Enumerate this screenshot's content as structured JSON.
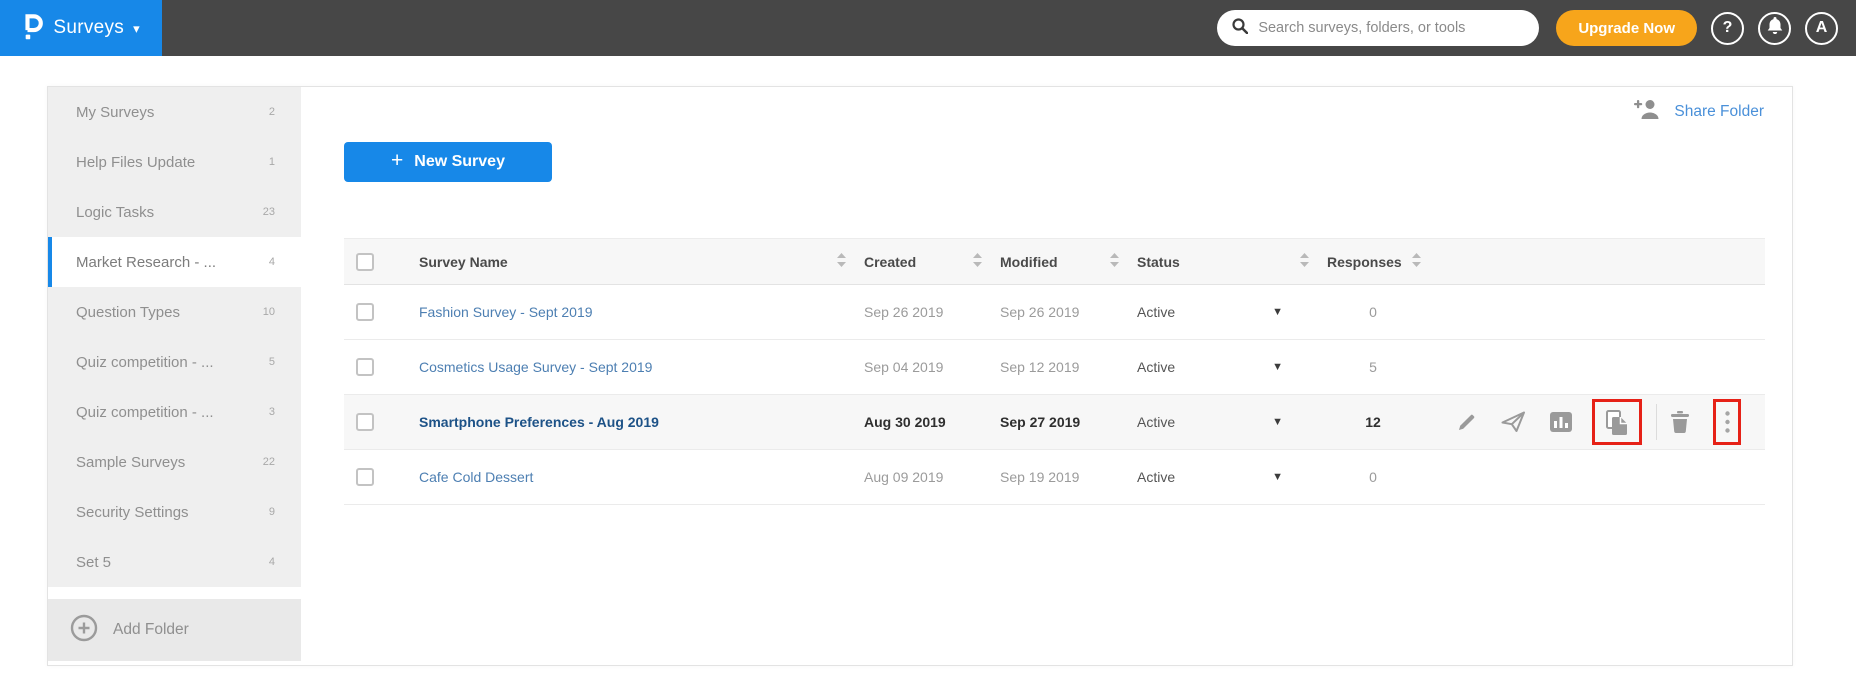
{
  "topbar": {
    "app_name": "Surveys",
    "search_placeholder": "Search surveys, folders, or tools",
    "upgrade_label": "Upgrade Now",
    "help_label": "?",
    "avatar_letter": "A"
  },
  "sidebar": {
    "items": [
      {
        "label": "My Surveys",
        "count": "2"
      },
      {
        "label": "Help Files Update",
        "count": "1"
      },
      {
        "label": "Logic Tasks",
        "count": "23"
      },
      {
        "label": "Market Research - ...",
        "count": "4"
      },
      {
        "label": "Question Types",
        "count": "10"
      },
      {
        "label": "Quiz competition - ...",
        "count": "5"
      },
      {
        "label": "Quiz competition - ...",
        "count": "3"
      },
      {
        "label": "Sample Surveys",
        "count": "22"
      },
      {
        "label": "Security Settings",
        "count": "9"
      },
      {
        "label": "Set 5",
        "count": "4"
      }
    ],
    "active_item": "Market Research - ...",
    "add_folder_label": "Add Folder"
  },
  "main": {
    "share_folder_label": "Share Folder",
    "new_survey_label": "New Survey",
    "new_survey_plus": "+",
    "table": {
      "headers": [
        "Survey Name",
        "Created",
        "Modified",
        "Status",
        "Responses"
      ],
      "rows": [
        {
          "name": "Fashion Survey - Sept 2019",
          "created": "Sep 26 2019",
          "modified": "Sep 26 2019",
          "status": "Active",
          "responses": "0"
        },
        {
          "name": "Cosmetics Usage Survey - Sept 2019",
          "created": "Sep 04 2019",
          "modified": "Sep 12 2019",
          "status": "Active",
          "responses": "5"
        },
        {
          "name": "Smartphone Preferences - Aug 2019",
          "created": "Aug 30 2019",
          "modified": "Sep 27 2019",
          "status": "Active",
          "responses": "12",
          "highlighted": true,
          "actions": [
            "edit",
            "send",
            "reports",
            "duplicate",
            "delete",
            "more"
          ],
          "highlighted_actions": [
            "duplicate",
            "more"
          ]
        },
        {
          "name": "Cafe Cold Dessert",
          "created": "Aug 09 2019",
          "modified": "Sep 19 2019",
          "status": "Active",
          "responses": "0"
        }
      ]
    }
  },
  "colors": {
    "topbar_bg": "#474747",
    "accent_blue": "#1788e8",
    "upgrade_orange": "#f7a51b",
    "link_blue": "#4d7fb2",
    "highlight_red": "#e62117",
    "sidebar_bg": "#efefef",
    "row_highlight_bg": "#f7f7f7",
    "icon_gray": "#9a9a9a"
  }
}
